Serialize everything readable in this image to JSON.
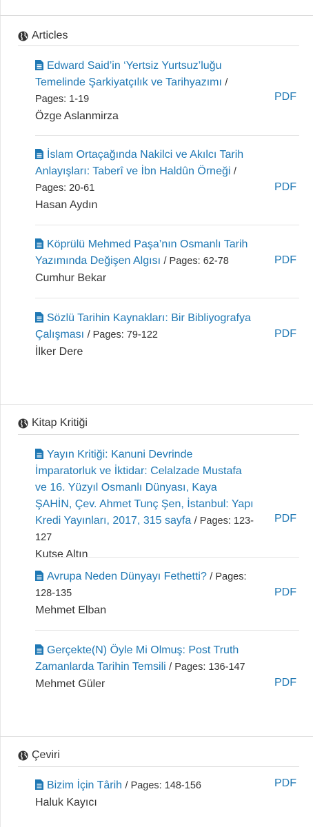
{
  "sections": [
    {
      "title": "Articles",
      "items": [
        {
          "title": "Edward Said’in ‘Yertsiz Yurtsuz’luğu Temelinde Şarkiyatçılık ve Tarihyazımı",
          "pages": "/ Pages: 1-19",
          "author": "Özge Aslanmirza",
          "pdf": "PDF"
        },
        {
          "title": "İslam Ortaçağında Nakilci ve Akılcı Tarih Anlayışları: Taberî ve İbn Haldûn Örneği",
          "pages": "/ Pages: 20-61",
          "author": "Hasan Aydın",
          "pdf": "PDF"
        },
        {
          "title": "Köprülü Mehmed Paşa’nın Osmanlı Tarih Yazımında Değişen Algısı",
          "pages": "/ Pages: 62-78",
          "author": "Cumhur Bekar",
          "pdf": "PDF"
        },
        {
          "title": "Sözlü Tarihin Kaynakları: Bir Bibliyografya Çalışması",
          "pages": "/ Pages: 79-122",
          "author": "İlker Dere",
          "pdf": "PDF"
        }
      ]
    },
    {
      "title": "Kitap Kritiği",
      "items": [
        {
          "title": "Yayın Kritiği: Kanuni Devrinde İmparatorluk ve İktidar: Celalzade Mustafa ve 16. Yüzyıl Osmanlı Dünyası, Kaya ŞAHİN, Çev. Ahmet Tunç Şen, İstanbul: Yapı Kredi Yayınları, 2017, 315 sayfa",
          "pages": "/ Pages: 123-127",
          "author": "Kutse Altın",
          "pdf": "PDF"
        },
        {
          "title": "Avrupa Neden Dünyayı Fethetti?",
          "pages": "/ Pages: 128-135",
          "author": "Mehmet Elban",
          "pdf": "PDF"
        },
        {
          "title": "Gerçekte(N) Öyle Mi Olmuş: Post Truth Zamanlarda Tarihin Temsili",
          "pages": "/ Pages: 136-147",
          "author": "Mehmet Güler",
          "pdf": "PDF"
        }
      ]
    },
    {
      "title": "Çeviri",
      "items": [
        {
          "title": "Bizim İçin Târih",
          "pages": "/ Pages: 148-156",
          "author": "Haluk Kayıcı",
          "pdf": "PDF"
        }
      ]
    }
  ],
  "icons": {
    "section": "globe-icon",
    "item": "file-text-icon"
  },
  "colors": {
    "link": "#1f78b4",
    "text": "#333333",
    "rule": "#dcdcdc"
  }
}
